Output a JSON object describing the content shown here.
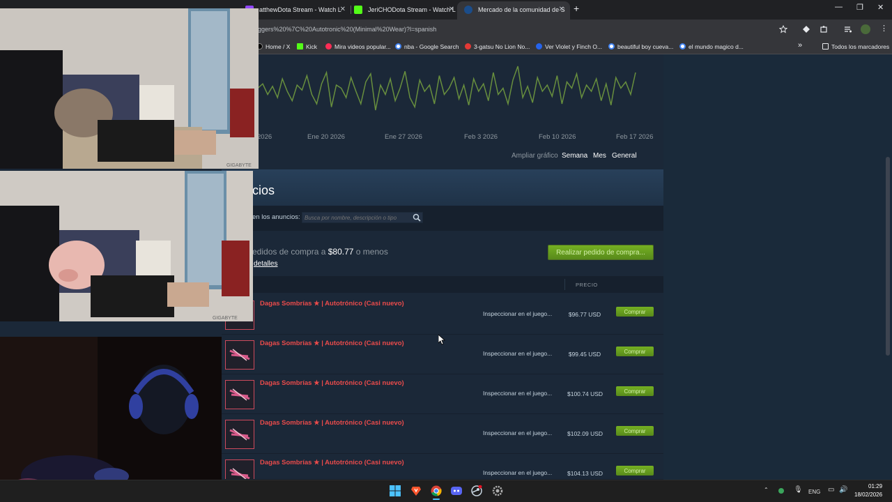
{
  "browser": {
    "tabs": [
      {
        "title": "atthewDota Stream - Watch L",
        "active": false
      },
      {
        "title": "JeriCHODota Stream - Watch L",
        "active": false
      },
      {
        "title": "Mercado de la comunidad de S",
        "active": true
      }
    ],
    "new_tab": "+",
    "close_glyph": "✕",
    "window_controls": {
      "minimize": "—",
      "maximize": "❐",
      "close": "✕"
    },
    "url": "ggers%20%7C%20Autotronic%20(Minimal%20Wear)?l=spanish",
    "bookmarks": [
      {
        "label": "Home / X",
        "color": "#000000"
      },
      {
        "label": "Kick",
        "color": "#53fc18"
      },
      {
        "label": "Mira videos popular...",
        "color": "#fe2c55"
      },
      {
        "label": "nba - Google Search",
        "color": "#4285f4"
      },
      {
        "label": "3-gatsu No Lion No...",
        "color": "#e53935"
      },
      {
        "label": "Ver Violet y Finch O...",
        "color": "#2563eb"
      },
      {
        "label": "beautiful boy cueva...",
        "color": "#4285f4"
      },
      {
        "label": "el mundo magico d...",
        "color": "#4285f4"
      }
    ],
    "bookmarks_overflow": "»",
    "all_bookmarks": "Todos los marcadores"
  },
  "chart_data": {
    "type": "line",
    "title": "",
    "xlabel": "",
    "ylabel": "",
    "x_tick_labels": [
      "2026",
      "Ene 20 2026",
      "Ene 27 2026",
      "Feb 3 2026",
      "Feb 10 2026",
      "Feb 17 2026"
    ],
    "series": [
      {
        "color": "#688f3e",
        "values": [
          0.55,
          0.62,
          0.45,
          0.58,
          0.4,
          0.7,
          0.5,
          0.35,
          0.6,
          0.52,
          0.75,
          0.45,
          0.3,
          0.62,
          0.8,
          0.25,
          0.6,
          0.55,
          0.4,
          0.72,
          0.5,
          0.3,
          0.65,
          0.78,
          0.2,
          0.6,
          0.45,
          0.7,
          0.35,
          0.55,
          0.82,
          0.4,
          0.25,
          0.68,
          0.5,
          0.6,
          0.3,
          0.75,
          0.45,
          0.55,
          0.72,
          0.38,
          0.6,
          0.28,
          0.7,
          0.5,
          0.62,
          0.35,
          0.8,
          0.45,
          0.55,
          0.3,
          0.68,
          0.9,
          0.4,
          0.58,
          0.32,
          0.72,
          0.5,
          0.6,
          0.42,
          0.75,
          0.3,
          0.65,
          0.55,
          0.78,
          0.4,
          0.6,
          0.5,
          0.7,
          0.35,
          0.62,
          0.28,
          0.72,
          0.55,
          0.65,
          0.45,
          0.8
        ]
      }
    ],
    "zoom_label": "Ampliar gráfico",
    "zoom_options": [
      "Semana",
      "Mes",
      "General"
    ]
  },
  "listings": {
    "title": "cios",
    "search_label": "en los anuncios:",
    "search_placeholder": "Busca por nombre, descripción o tipo",
    "buy_order_prefix": "edidos de compra a",
    "buy_order_price": "$80.77",
    "buy_order_suffix": "o menos",
    "details_link": "detalles",
    "buy_order_button": "Realizar pedido de compra...",
    "price_header": "PRECIO",
    "rows": [
      {
        "name": "Dagas Sombrías ★ | Autotrónico (Casi nuevo)",
        "inspect": "Inspeccionar en el juego...",
        "price": "$96.77 USD",
        "buy": "Comprar"
      },
      {
        "name": "Dagas Sombrías ★ | Autotrónico (Casi nuevo)",
        "inspect": "Inspeccionar en el juego...",
        "price": "$99.45 USD",
        "buy": "Comprar"
      },
      {
        "name": "Dagas Sombrías ★ | Autotrónico (Casi nuevo)",
        "inspect": "Inspeccionar en el juego...",
        "price": "$100.74 USD",
        "buy": "Comprar"
      },
      {
        "name": "Dagas Sombrías ★ | Autotrónico (Casi nuevo)",
        "inspect": "Inspeccionar en el juego...",
        "price": "$102.09 USD",
        "buy": "Comprar"
      },
      {
        "name": "Dagas Sombrías ★ | Autotrónico (Casi nuevo)",
        "inspect": "Inspeccionar en el juego...",
        "price": "$104.13 USD",
        "buy": "Comprar"
      }
    ]
  },
  "webcam": {
    "brand_label": "GIGABYTE"
  },
  "taskbar": {
    "icons": [
      "windows-start-icon",
      "brave-icon",
      "chrome-icon",
      "discord-icon",
      "steam-icon",
      "settings-icon"
    ],
    "tray_lang": "ENG",
    "time": "01:29",
    "date": "18/02/2026"
  }
}
